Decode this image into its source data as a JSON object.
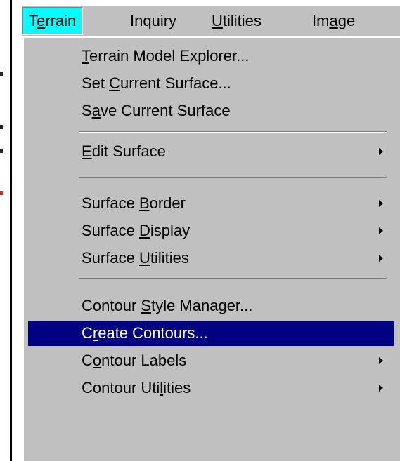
{
  "menubar": {
    "items": [
      {
        "label": "Terrain",
        "mnemonic": 1
      },
      {
        "label": "Inquiry",
        "mnemonic": -1
      },
      {
        "label": "Utilities",
        "mnemonic": 0
      },
      {
        "label": "Image",
        "mnemonic": 2
      }
    ],
    "active_index": 0
  },
  "dropdown": {
    "groups": [
      [
        {
          "label": "Terrain Model Explorer...",
          "mnemonic": 0,
          "submenu": false
        },
        {
          "label": "Set Current Surface...",
          "mnemonic": 4,
          "submenu": false
        },
        {
          "label": "Save Current Surface",
          "mnemonic": 1,
          "submenu": false
        }
      ],
      [
        {
          "label": "Edit Surface",
          "mnemonic": 0,
          "submenu": true
        }
      ],
      [
        {
          "label": "Surface Border",
          "mnemonic": 8,
          "submenu": true
        },
        {
          "label": "Surface Display",
          "mnemonic": 8,
          "submenu": true
        },
        {
          "label": "Surface Utilities",
          "mnemonic": 8,
          "submenu": true
        }
      ],
      [
        {
          "label": "Contour Style Manager...",
          "mnemonic": 8,
          "submenu": false
        },
        {
          "label": "Create Contours...",
          "mnemonic": 1,
          "submenu": false,
          "highlighted": true
        },
        {
          "label": "Contour Labels",
          "mnemonic": 1,
          "submenu": true
        },
        {
          "label": "Contour Utilities",
          "mnemonic": 11,
          "submenu": true
        }
      ]
    ]
  },
  "colors": {
    "menu_bg": "#c0c0c0",
    "active_title_bg": "#00ffff",
    "highlight_bg": "#000080",
    "highlight_text": "#ffffff"
  }
}
